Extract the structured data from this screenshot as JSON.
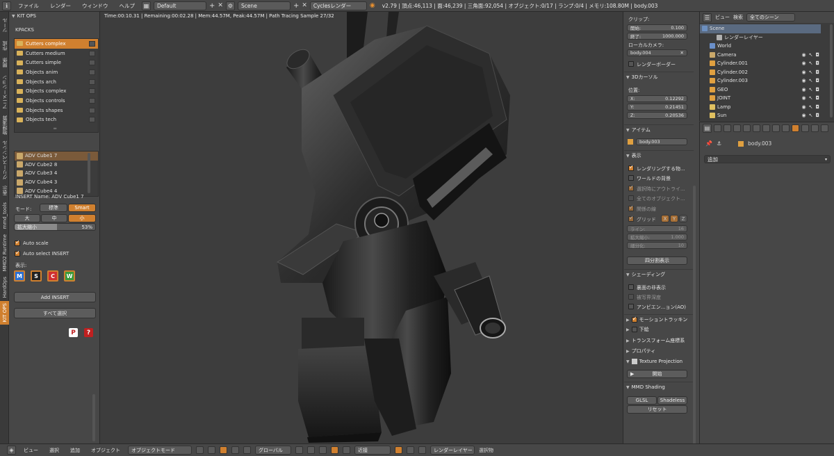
{
  "topbar": {
    "menu": [
      "ファイル",
      "レンダー",
      "ウィンドウ",
      "ヘルプ"
    ],
    "screen_layout": "Default",
    "scene": "Scene",
    "engine": "Cyclesレンダー",
    "stats": "v2.79 | 頂点:46,113 | 面:46,239 | 三角面:92,054 | オブジェクト:0/17 | ランプ:0/4 | メモリ:108.80M | body.003"
  },
  "vertical_tabs": [
    "ツール",
    "作成",
    "関係",
    "アニメーション",
    "物理演算",
    "グリースペンシル",
    "表示",
    "mmd_tools",
    "MMD2 Runtime",
    "HardOps",
    "KIT OPS"
  ],
  "kitops": {
    "panel_title": "KIT OPS",
    "kpacks_label": "KPACKS",
    "kpacks": [
      "Cutters complex",
      "Cutters medium",
      "Cutters simple",
      "Objects anim",
      "Objects arch",
      "Objects complex",
      "Objects controls",
      "Objects shapes",
      "Objects tech"
    ],
    "inserts": [
      "ADV Cube1 7",
      "ADV Cube2 8",
      "ADV Cube3 4",
      "ADV Cube4 3",
      "ADV Cube4 4"
    ],
    "insert_name": "INSERT Name: ADV Cube1 7",
    "mode_label": "モード:",
    "mode_options": [
      "標準",
      "Smart"
    ],
    "size_options": [
      "大",
      "中",
      "小"
    ],
    "scale_label": "拡大縮小",
    "scale_value": "53%",
    "scale_fraction": 0.53,
    "auto_scale": "Auto scale",
    "auto_select": "Auto select INSERT",
    "display_label": "表示:",
    "display_icons": [
      "M",
      "S",
      "C",
      "W"
    ],
    "add_insert": "Add INSERT",
    "select_all": "すべて選択"
  },
  "viewport": {
    "info": "Time:00:10.31 | Remaining:00:02.28 | Mem:44.57M, Peak:44.57M | Path Tracing Sample 27/32"
  },
  "npanel": {
    "clip_label": "クリップ:",
    "clip_start_label": "開始:",
    "clip_start": "0.100",
    "clip_end_label": "終了:",
    "clip_end": "1000.000",
    "local_camera": "ローカルカメラ:",
    "camera_object": "body.004",
    "render_border": "レンダーボーダー",
    "cursor_title": "3Dカーソル",
    "location": "位置:",
    "x_label": "X:",
    "x": "0.12292",
    "y_label": "Y:",
    "y": "0.21451",
    "z_label": "Z:",
    "z": "0.20536",
    "item_title": "アイテム",
    "item_name": "body.003",
    "display_title": "表示",
    "only_render": "レンダリングする物...",
    "world_bg": "ワールドの背景",
    "outline_selected": "選択時にアウトライ...",
    "all_object_origins": "全てのオブジェクト...",
    "relationship_lines": "関係の線",
    "grid": "グリッド",
    "grid_axes": [
      "X",
      "Y",
      "Z"
    ],
    "lines_label": "ライン:",
    "lines": "16",
    "scale_label": "拡大縮小:",
    "scale": "1.000",
    "subdiv_label": "細分化:",
    "subdiv": "10",
    "quad_view": "四分割表示",
    "shading_title": "シェーディング",
    "backface": "裏面の非表示",
    "dof": "被写界深度",
    "ao": "アンビエン...ョン(AO)",
    "motion_tracking": "モーショントラッキン",
    "background": "下絵",
    "transform_orient": "トランスフォーム座標系",
    "properties": "プロパティ",
    "texture_projection": "Texture Projection",
    "start": "開始",
    "mmd_shading": "MMD Shading",
    "glsl": "GLSL",
    "shadeless": "Shadeless",
    "reset": "リセット"
  },
  "outliner": {
    "header": [
      "ビュー",
      "検索",
      "全てのシーン"
    ],
    "items": [
      {
        "name": "Scene",
        "color": "#6c8fbf"
      },
      {
        "name": "レンダーレイヤー",
        "color": "#b0b0b0"
      },
      {
        "name": "World",
        "color": "#6a8fc9"
      },
      {
        "name": "Camera",
        "color": "#caa86a"
      },
      {
        "name": "Cylinder.001",
        "color": "#e0a040"
      },
      {
        "name": "Cylinder.002",
        "color": "#e0a040"
      },
      {
        "name": "Cylinder.003",
        "color": "#e0a040"
      },
      {
        "name": "GEO",
        "color": "#e0a040"
      },
      {
        "name": "JOINT",
        "color": "#e0a040"
      },
      {
        "name": "Lamp",
        "color": "#e0c060"
      },
      {
        "name": "Sun",
        "color": "#e0c060"
      }
    ]
  },
  "properties": {
    "object_name": "body.003",
    "add_label": "追加"
  },
  "bottombar": {
    "menu": [
      "ビュー",
      "選択",
      "追加",
      "オブジェクト"
    ],
    "mode": "オブジェクトモード",
    "orientation": "グローバル",
    "snap": "近接",
    "render_layer": "レンダーレイヤー",
    "selected": "選択物"
  },
  "colors": {
    "accent": "#d0802f",
    "panel": "#474747",
    "viewport_bg": "#3d3d3d"
  }
}
